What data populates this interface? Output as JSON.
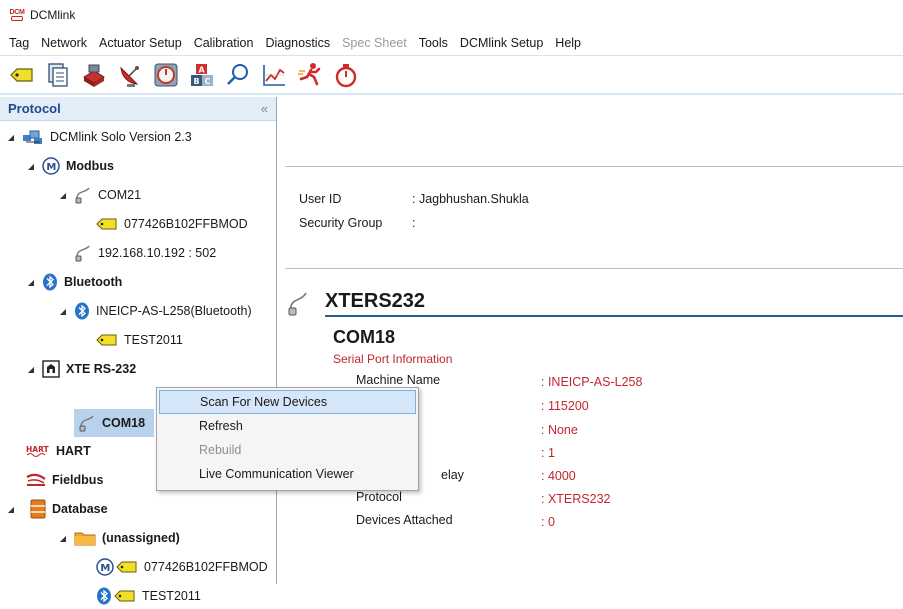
{
  "window": {
    "title": "DCMlink",
    "logo_text": "DCM"
  },
  "menu": [
    "Tag",
    "Network",
    "Actuator Setup",
    "Calibration",
    "Diagnostics",
    "Spec Sheet",
    "Tools",
    "DCMlink Setup",
    "Help"
  ],
  "menu_disabled": [
    "Spec Sheet"
  ],
  "toolbar": [
    "tag-icon",
    "document-icon",
    "network-device-icon",
    "satellite-dish-icon",
    "gauge-icon",
    "abc-blocks-icon",
    "search-icon",
    "chart-icon",
    "runner-icon",
    "stopwatch-icon"
  ],
  "panel": {
    "title": "Protocol",
    "collapse": "«"
  },
  "tree": {
    "root": "DCMlink Solo Version 2.3",
    "modbus": "Modbus",
    "com21": "COM21",
    "modbus_device": "077426B102FFBMOD",
    "ip": "192.168.10.192 : 502",
    "bluetooth": "Bluetooth",
    "bt_host": "INEICP-AS-L258(Bluetooth)",
    "bt_device": "TEST2011",
    "xte": "XTE RS-232",
    "com18": "COM18",
    "hart": "HART",
    "fieldbus": "Fieldbus",
    "database": "Database",
    "unassigned": "(unassigned)",
    "db_device1": "077426B102FFBMOD",
    "db_device2": "TEST2011",
    "modbus_badge": "M"
  },
  "user": {
    "id_label": "User ID",
    "id_value": ": Jagbhushan.Shukla",
    "group_label": "Security Group",
    "group_value": ":"
  },
  "detail": {
    "title": "XTERS232",
    "port": "COM18",
    "section": "Serial Port Information",
    "labels": {
      "machine": "Machine Name",
      "delay_suffix": "elay",
      "protocol": "Protocol",
      "devices": "Devices Attached"
    },
    "values": [
      ": INEICP-AS-L258",
      ": 115200",
      ": None",
      ": 1",
      ": 4000",
      ": XTERS232",
      ": 0"
    ]
  },
  "context_menu": [
    "Scan For New Devices",
    "Refresh",
    "Rebuild",
    "Live Communication Viewer"
  ],
  "colors": {
    "accent": "#1e4a8a",
    "value_red": "#c0262d",
    "selection": "#b8d2ee",
    "header_bg": "#e3edf8"
  }
}
